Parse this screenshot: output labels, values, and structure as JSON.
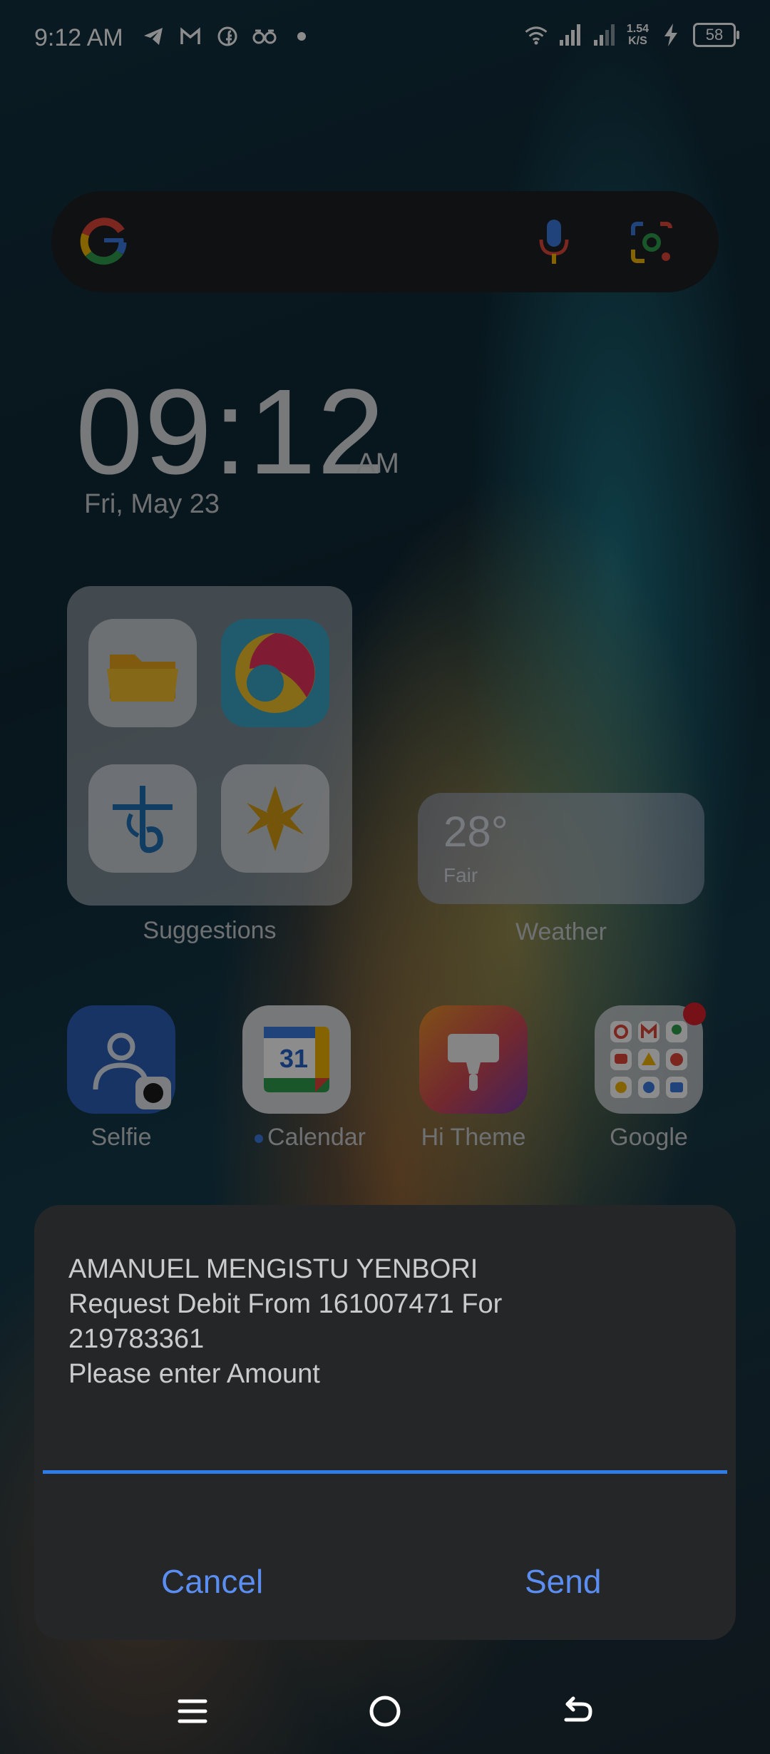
{
  "status_bar": {
    "time": "9:12 AM",
    "left_icons": [
      "telegram-icon",
      "gmail-icon",
      "facebook-icon",
      "infinity-app-icon",
      "dot-icon"
    ],
    "net_speed_value": "1.54",
    "net_speed_unit": "K/S",
    "battery": "58"
  },
  "search": {
    "logo": "google-g-icon",
    "voice": "mic-icon",
    "lens": "google-lens-icon"
  },
  "clock": {
    "time": "09:12",
    "ampm": "AM",
    "date": "Fri, May 23"
  },
  "folder": {
    "label": "Suggestions",
    "apps": [
      "files-app-icon",
      "browser-app-icon",
      "bank-app-icon",
      "star-app-icon"
    ]
  },
  "weather": {
    "temp": "28°",
    "condition": "Fair",
    "label": "Weather"
  },
  "dock": [
    {
      "label": "Selfie"
    },
    {
      "label": "Calendar",
      "icon_text": "31"
    },
    {
      "label": "Hi Theme"
    },
    {
      "label": "Google"
    }
  ],
  "dialog": {
    "line1": "AMANUEL MENGISTU YENBORI",
    "line2": "Request Debit From 161007471 For",
    "line3": "219783361",
    "line4": "Please enter Amount",
    "input_value": "",
    "cancel": "Cancel",
    "send": "Send",
    "accent": "#5b8ef2"
  },
  "nav": {
    "menu": "menu-icon",
    "home": "home-icon",
    "back": "back-icon"
  }
}
